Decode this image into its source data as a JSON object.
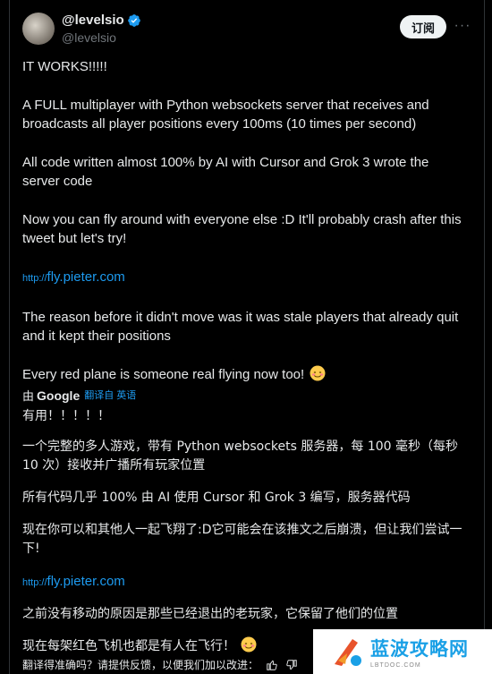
{
  "author": {
    "name": "@levelsio",
    "handle": "@levelsio",
    "verified_color": "#1d9bf0"
  },
  "actions": {
    "subscribe_label": "订阅",
    "more_label": "···"
  },
  "tweet": {
    "p1": "IT WORKS!!!!!",
    "p2": "A FULL multiplayer with Python websockets server that receives and broadcasts all player positions every 100ms (10 times per second)",
    "p3": "All code written almost 100% by AI with Cursor and Grok 3 wrote the server code",
    "p4": "Now you can fly around with everyone else :D It'll probably crash after this tweet but let's try!",
    "link_prefix": "http://",
    "link_host": "fly.pieter.com",
    "p5": "The reason before it didn't move was it was stale players that already quit and it kept their positions",
    "p6": "Every red plane is someone real flying now too!"
  },
  "translation": {
    "by_label": "由",
    "provider": "Google",
    "lang_label": "翻译自 英语",
    "t1": "有用！！！！！",
    "t2": "一个完整的多人游戏，带有 Python websockets 服务器，每 100 毫秒（每秒 10 次）接收并广播所有玩家位置",
    "t3": "所有代码几乎 100% 由 AI 使用 Cursor 和 Grok 3 编写，服务器代码",
    "t4": "现在你可以和其他人一起飞翔了:D它可能会在该推文之后崩溃，但让我们尝试一下!",
    "link_prefix": "http://",
    "link_host": "fly.pieter.com",
    "t5": "之前没有移动的原因是那些已经退出的老玩家，它保留了他们的位置",
    "t6": "现在每架红色飞机也都是有人在飞行！",
    "feedback": "翻译得准确吗？请提供反馈，以便我们加以改进："
  },
  "watermark": {
    "title": "蓝波攻略网",
    "subtitle": "LBTDOC.COM"
  },
  "colors": {
    "background": "#000000",
    "text": "#e7e9ea",
    "muted": "#71767b",
    "link": "#1d9bf0"
  }
}
